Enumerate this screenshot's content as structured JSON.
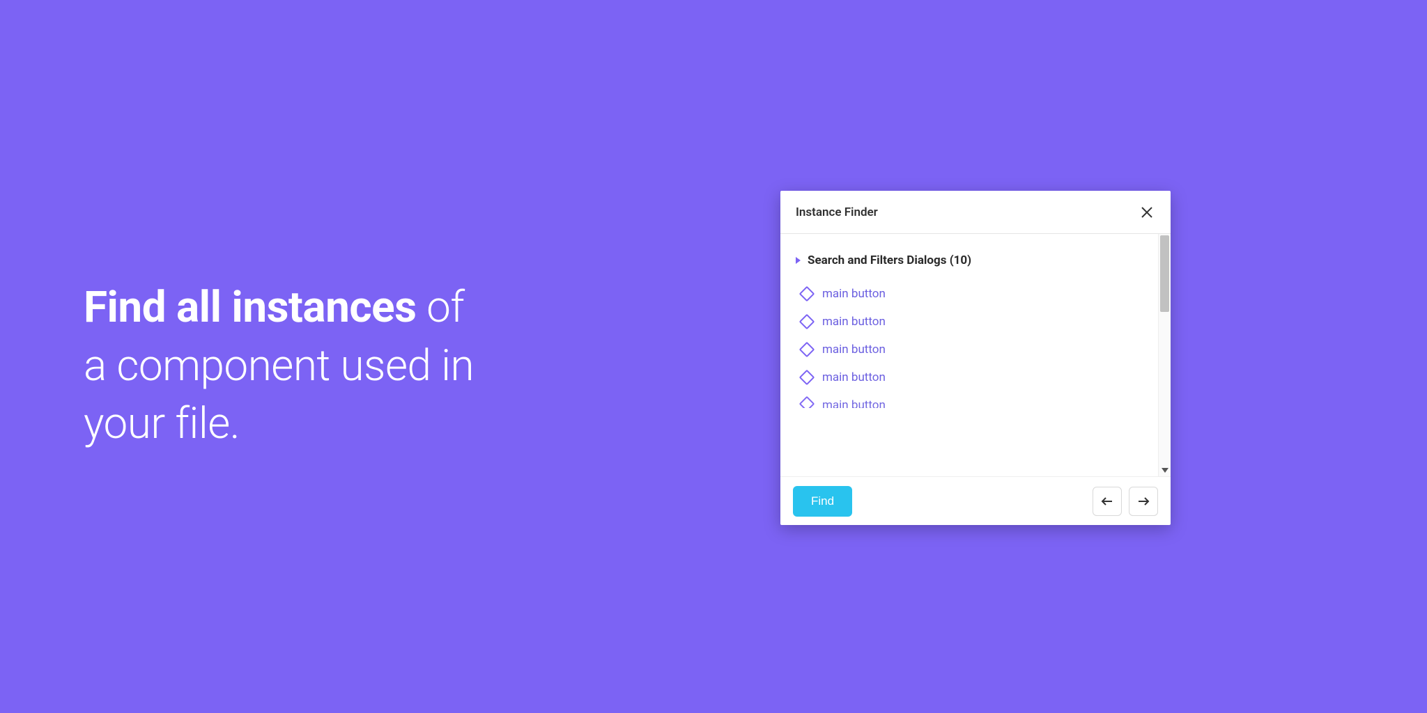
{
  "hero": {
    "bold": "Find all instances",
    "rest1": " of",
    "line2": "a component used in",
    "line3": "your file."
  },
  "panel": {
    "title": "Instance Finder",
    "group": {
      "name": "Search and Filters Dialogs",
      "count": 10,
      "label": "Search and Filters Dialogs (10)"
    },
    "instances": [
      {
        "label": "main button"
      },
      {
        "label": "main button"
      },
      {
        "label": "main button"
      },
      {
        "label": "main button"
      },
      {
        "label": "main button"
      }
    ],
    "find_label": "Find"
  },
  "colors": {
    "background": "#7c63f4",
    "accent_button": "#29c3ee",
    "instance_text": "#6b5fe0"
  }
}
